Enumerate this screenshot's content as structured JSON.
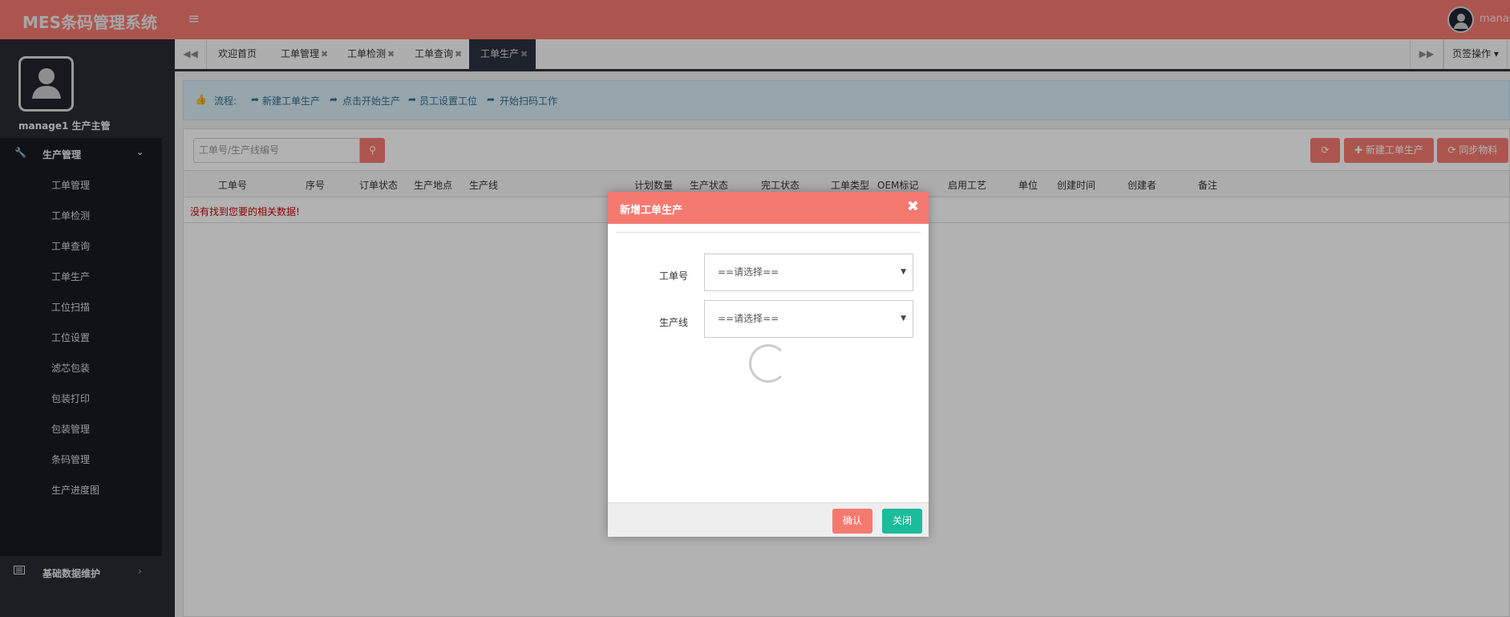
{
  "header": {
    "title": "MES条码管理系统",
    "menu_icon": "≡",
    "user": "manag"
  },
  "sidebar": {
    "user_label": "manage1 生产主管",
    "group1": {
      "label": "生产管理",
      "items": [
        "工单管理",
        "工单检测",
        "工单查询",
        "工单生产",
        "工位扫描",
        "工位设置",
        "滤芯包装",
        "包装打印",
        "包装管理",
        "条码管理",
        "生产进度图"
      ]
    },
    "group2": {
      "label": "基础数据维护"
    }
  },
  "tabs": {
    "items": [
      {
        "label": "欢迎首页"
      },
      {
        "label": "工单管理"
      },
      {
        "label": "工单检测"
      },
      {
        "label": "工单查询"
      },
      {
        "label": "工单生产"
      }
    ],
    "close": "✖",
    "page_ops": "页签操作 ▾"
  },
  "flow": {
    "label": "流程:",
    "steps": [
      "新建工单生产",
      "点击开始生产",
      "员工设置工位",
      "开始扫码工作"
    ]
  },
  "toolbar": {
    "search_placeholder": "工单号/生产线编号",
    "new_label": "新建工单生产",
    "sync_label": "同步物料"
  },
  "table": {
    "columns": [
      "工单号",
      "序号",
      "订单状态",
      "生产地点",
      "生产线",
      "计划数量",
      "生产状态",
      "完工状态",
      "工单类型",
      "OEM标记",
      "启用工艺",
      "单位",
      "创建时间",
      "创建者",
      "备注"
    ],
    "empty": "没有找到您要的相关数据!"
  },
  "modal": {
    "title": "新增工单生产",
    "fields": [
      {
        "label": "工单号",
        "value": "==请选择=="
      },
      {
        "label": "生产线",
        "value": "==请选择=="
      }
    ],
    "confirm": "确认",
    "close": "关闭"
  },
  "colors": {
    "accent": "#f77a70",
    "success": "#1abc9c"
  }
}
